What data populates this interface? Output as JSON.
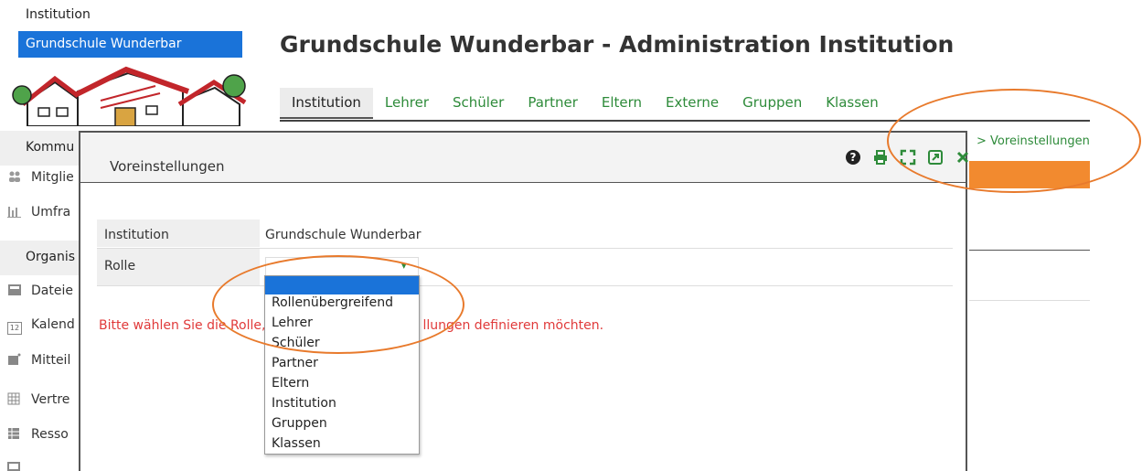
{
  "sidebar": {
    "top_label": "Institution",
    "school_selector": "Grundschule Wunderbar",
    "sections": [
      {
        "heading": "Kommu"
      },
      {
        "heading": "Organis"
      }
    ],
    "items": [
      {
        "label": "Mitglie",
        "icon": "members-icon"
      },
      {
        "label": "Umfra",
        "icon": "survey-chart-icon"
      },
      {
        "label": "Dateie",
        "icon": "files-icon"
      },
      {
        "label": "Kalend",
        "icon": "calendar-icon"
      },
      {
        "label": "Mitteil",
        "icon": "messages-icon"
      },
      {
        "label": "Vertre",
        "icon": "substitution-icon"
      },
      {
        "label": "Resso",
        "icon": "resources-icon"
      }
    ],
    "calendar_icon_text": "12"
  },
  "main": {
    "title": "Grundschule Wunderbar - Administration Institution",
    "tabs": [
      {
        "label": "Institution",
        "active": true
      },
      {
        "label": "Lehrer"
      },
      {
        "label": "Schüler"
      },
      {
        "label": "Partner"
      },
      {
        "label": "Eltern"
      },
      {
        "label": "Externe"
      },
      {
        "label": "Gruppen"
      },
      {
        "label": "Klassen"
      }
    ],
    "breadcrumb_chevron": ">",
    "breadcrumb": "Voreinstellungen"
  },
  "dialog": {
    "title": "Voreinstellungen",
    "icons": [
      "help-icon",
      "print-icon",
      "expand-icon",
      "open-external-icon",
      "close-icon"
    ],
    "fields": {
      "institution_label": "Institution",
      "institution_value": "Grundschule Wunderbar",
      "role_label": "Rolle",
      "role_selected": ""
    },
    "hint_before": "Bitte wählen Sie die Rolle,",
    "hint_after": "llungen definieren möchten.",
    "role_options": [
      "",
      "Rollenübergreifend",
      "Lehrer",
      "Schüler",
      "Partner",
      "Eltern",
      "Institution",
      "Gruppen",
      "Klassen"
    ]
  },
  "colors": {
    "accent_blue": "#1a73d9",
    "link_green": "#2e8b3a",
    "warning_red": "#e03a3a",
    "highlight_orange": "#f28a2f",
    "annotation_orange": "#e87a2c"
  }
}
